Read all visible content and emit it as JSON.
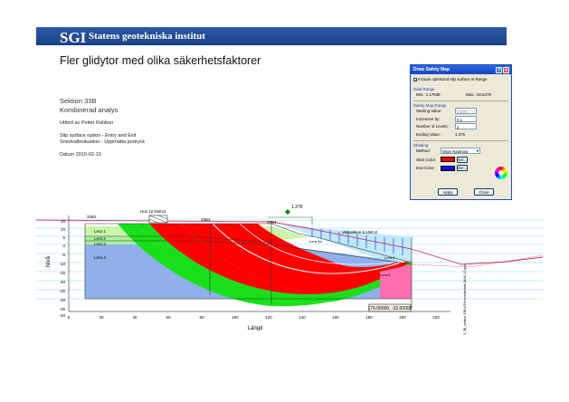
{
  "header": {
    "logo": "SGI",
    "org": "Statens geotekniska institut"
  },
  "title": "Fler glidytor med olika säkerhetsfaktorer",
  "info": {
    "section": "Sektion 33B",
    "analysis": "Kombinerad analys",
    "author": "Utförd av Petter Rahbon",
    "slip_option": "Slip surface option - Entry and Exit",
    "situation": "Snedvallssituation - Uppmätta portryck",
    "date": "Datum 2010-02-10"
  },
  "dialog": {
    "title": "Draw Safety Map",
    "include_label": "Include optimized slip surface in Range",
    "data_range_heading": "Data Range",
    "min_label": "Min.: 1.17938",
    "max_label": "Max.: 03.5478",
    "map_range_heading": "Safety Map Range",
    "starting_label": "Starting Value:",
    "starting_value": "1.376",
    "increment_label": "Increment by:",
    "increment_value": "0.1",
    "levels_label": "Number of Levels:",
    "levels_value": "2",
    "ending_label": "Ending Value:",
    "ending_value": "1.376",
    "shading_heading": "Shading",
    "method_label": "Method:",
    "method_value": "Wide Rainbow",
    "start_color_label": "Start Color:",
    "end_color_label": "End Color:",
    "set_label": "Set...",
    "apply_label": "Apply",
    "close_label": "Close",
    "help_glyph": "?",
    "close_glyph": "✕",
    "start_color": "#ff0000",
    "end_color": "#1010ff"
  },
  "chart": {
    "top_labels": {
      "lower_left": "33B2",
      "load": "Hus 10 kN/m2",
      "mid": "33B3",
      "right": "33B4",
      "factor": "1.376",
      "value_box": "1.17",
      "soft_load": "Vallsektion 6 kN/m2",
      "floor_label": "Lera 3a",
      "clay_right": "Lera 2",
      "bottom_right": "Lera 6",
      "tail_left": "Lera"
    },
    "layers": [
      "Lera 1",
      "Lera 2",
      "Lera 3",
      "Lera 4"
    ],
    "ylabel": "Nivå",
    "xlabel": "Längd",
    "y_ticks": [
      "15",
      "10",
      "5",
      "0",
      "-5",
      "-10",
      "-15",
      "-20",
      "-25",
      "-30",
      "-35",
      "-40"
    ],
    "x_ticks": [
      "0",
      "20",
      "40",
      "60",
      "80",
      "100",
      "120",
      "140",
      "160",
      "180",
      "200",
      "220"
    ],
    "coord_readout": "179.00000, -32.00000",
    "side_label": "3_3B_sektion 33B A 5% sensitivitets-DK40-10.gsz"
  }
}
